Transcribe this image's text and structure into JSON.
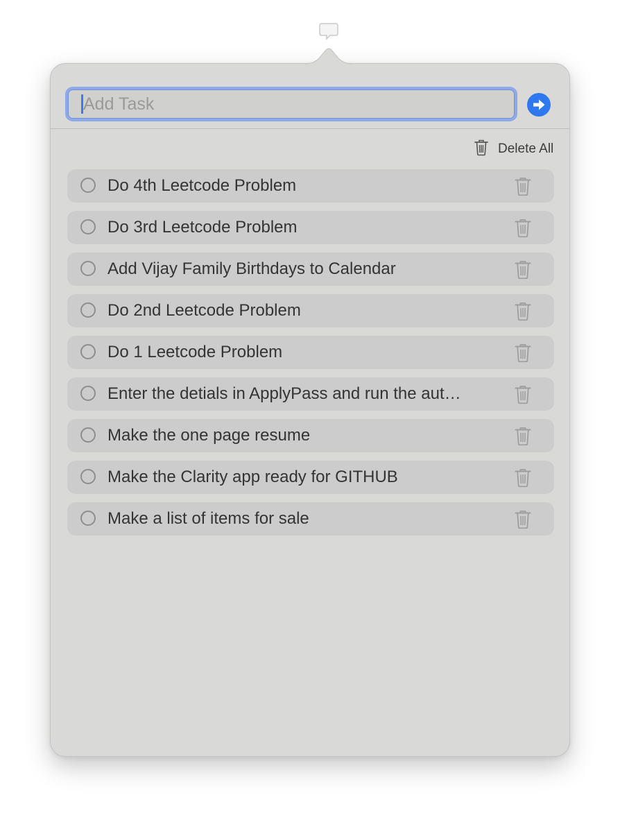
{
  "menubar": {
    "icon": "speech-bubble-icon"
  },
  "input": {
    "placeholder": "Add Task",
    "value": "",
    "submit_icon": "arrow-right-circle-icon",
    "accent_color": "#2f78ef",
    "focus_ring_color": "#8ea9e8"
  },
  "actions": {
    "delete_all_label": "Delete All",
    "delete_all_icon": "trash-icon"
  },
  "tasks": [
    {
      "title": "Do 4th Leetcode Problem",
      "completed": false
    },
    {
      "title": "Do 3rd Leetcode Problem",
      "completed": false
    },
    {
      "title": "Add Vijay Family Birthdays to Calendar",
      "completed": false
    },
    {
      "title": "Do 2nd Leetcode Problem",
      "completed": false
    },
    {
      "title": "Do 1 Leetcode Problem",
      "completed": false
    },
    {
      "title": "Enter the detials in ApplyPass and run the aut…",
      "completed": false
    },
    {
      "title": "Make the one page resume",
      "completed": false
    },
    {
      "title": "Make the Clarity app ready for GITHUB",
      "completed": false
    },
    {
      "title": "Make a list of items for sale",
      "completed": false
    }
  ],
  "colors": {
    "popover_bg": "#d9dad8",
    "row_bg": "#cbcccb",
    "text": "#343434"
  }
}
